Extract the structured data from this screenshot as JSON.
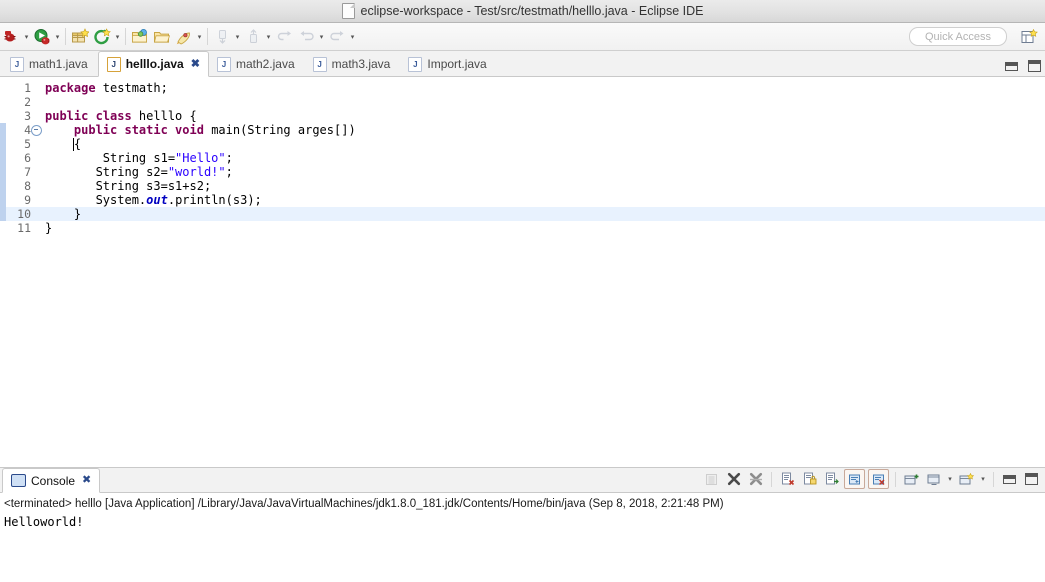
{
  "window": {
    "title": "eclipse-workspace - Test/src/testmath/helllo.java - Eclipse IDE",
    "doc_icon": "document-icon"
  },
  "toolbar": {
    "quick_access_placeholder": "Quick Access",
    "items": [
      {
        "name": "debug-button",
        "icon": "bug-icon"
      },
      {
        "name": "debug-dropdown",
        "icon": "chevron-down-icon"
      },
      {
        "name": "run-button",
        "icon": "run-green-play-icon"
      },
      {
        "name": "run-dropdown",
        "icon": "chevron-down-icon"
      },
      {
        "name": "new-java-package-button",
        "icon": "package-icon"
      },
      {
        "name": "external-tools-button",
        "icon": "external-tools-icon"
      },
      {
        "name": "external-tools-dropdown",
        "icon": "chevron-down-icon"
      },
      {
        "name": "new-folder-button",
        "icon": "folder-star-icon"
      },
      {
        "name": "open-folder-button",
        "icon": "open-folder-icon"
      },
      {
        "name": "search-button",
        "icon": "rocket-search-icon"
      },
      {
        "name": "search-dropdown",
        "icon": "chevron-down-icon"
      },
      {
        "name": "next-annotation-button",
        "icon": "next-annotation-icon"
      },
      {
        "name": "next-annotation-dropdown",
        "icon": "chevron-down-icon"
      },
      {
        "name": "previous-annotation-button",
        "icon": "previous-annotation-icon"
      },
      {
        "name": "previous-annotation-dropdown",
        "icon": "chevron-down-icon"
      },
      {
        "name": "last-edit-location-button",
        "icon": "last-edit-icon"
      },
      {
        "name": "back-button",
        "icon": "back-arrow-icon"
      },
      {
        "name": "back-dropdown",
        "icon": "chevron-down-icon"
      },
      {
        "name": "forward-button",
        "icon": "forward-arrow-icon"
      },
      {
        "name": "forward-dropdown",
        "icon": "chevron-down-icon"
      }
    ],
    "perspective_icon": "open-perspective-icon"
  },
  "editor": {
    "tabs": [
      {
        "label": "math1.java",
        "active": false,
        "closable": false
      },
      {
        "label": "helllo.java",
        "active": true,
        "closable": true
      },
      {
        "label": "math2.java",
        "active": false,
        "closable": false
      },
      {
        "label": "math3.java",
        "active": false,
        "closable": false
      },
      {
        "label": "Import.java",
        "active": false,
        "closable": false
      }
    ],
    "tab_icon": "java-file-icon",
    "close_glyph": "✖",
    "minimize_icon": "minimize-icon",
    "maximize_icon": "maximize-icon",
    "lines": [
      {
        "num": "1",
        "fold": false,
        "changed": false,
        "current": false,
        "tokens": [
          {
            "t": "package ",
            "c": "kw"
          },
          {
            "t": "testmath;",
            "c": ""
          }
        ]
      },
      {
        "num": "2",
        "fold": false,
        "changed": false,
        "current": false,
        "tokens": [
          {
            "t": "",
            "c": ""
          }
        ]
      },
      {
        "num": "3",
        "fold": false,
        "changed": false,
        "current": false,
        "tokens": [
          {
            "t": "public class ",
            "c": "kw"
          },
          {
            "t": "helllo {",
            "c": ""
          }
        ]
      },
      {
        "num": "4",
        "fold": true,
        "changed": true,
        "current": false,
        "tokens": [
          {
            "t": "    ",
            "c": ""
          },
          {
            "t": "public static void ",
            "c": "kw"
          },
          {
            "t": "main(String arges[])",
            "c": ""
          }
        ]
      },
      {
        "num": "5",
        "fold": false,
        "changed": true,
        "current": false,
        "tokens": [
          {
            "t": "    {",
            "c": ""
          }
        ]
      },
      {
        "num": "6",
        "fold": false,
        "changed": true,
        "current": false,
        "tokens": [
          {
            "t": "        String s1=",
            "c": ""
          },
          {
            "t": "\"Hello\"",
            "c": "str"
          },
          {
            "t": ";",
            "c": ""
          }
        ]
      },
      {
        "num": "7",
        "fold": false,
        "changed": true,
        "current": false,
        "tokens": [
          {
            "t": "       String s2=",
            "c": ""
          },
          {
            "t": "\"world!\"",
            "c": "str"
          },
          {
            "t": ";",
            "c": ""
          }
        ]
      },
      {
        "num": "8",
        "fold": false,
        "changed": true,
        "current": false,
        "tokens": [
          {
            "t": "       String s3=s1+s2;",
            "c": ""
          }
        ]
      },
      {
        "num": "9",
        "fold": false,
        "changed": true,
        "current": false,
        "tokens": [
          {
            "t": "       System.",
            "c": ""
          },
          {
            "t": "out",
            "c": "fld"
          },
          {
            "t": ".println(s3);",
            "c": ""
          }
        ]
      },
      {
        "num": "10",
        "fold": false,
        "changed": true,
        "current": true,
        "tokens": [
          {
            "t": "    }",
            "c": ""
          }
        ]
      },
      {
        "num": "11",
        "fold": false,
        "changed": false,
        "current": false,
        "tokens": [
          {
            "t": "}",
            "c": ""
          }
        ]
      }
    ]
  },
  "console": {
    "tab_label": "Console",
    "tab_icon": "console-icon",
    "close_glyph": "✖",
    "toolbar_items": [
      {
        "name": "scroll-lock-button",
        "icon": "scroll-lock-icon",
        "enabled": false
      },
      {
        "name": "terminate-button",
        "icon": "terminate-x-icon",
        "enabled": true
      },
      {
        "name": "remove-all-terminated-button",
        "icon": "remove-all-terminated-icon",
        "enabled": true
      },
      {
        "name": "clear-console-button",
        "icon": "clear-console-icon",
        "enabled": true
      },
      {
        "name": "lock-console-button",
        "icon": "lock-icon",
        "enabled": true
      },
      {
        "name": "show-console-on-output-button",
        "icon": "show-on-output-icon",
        "enabled": true
      },
      {
        "name": "word-wrap-button",
        "icon": "word-wrap-icon",
        "enabled": true
      },
      {
        "name": "pin-console-button",
        "icon": "pin-console-icon",
        "enabled": true
      },
      {
        "name": "open-console-button",
        "icon": "open-console-icon",
        "enabled": true
      },
      {
        "name": "display-selected-console-button",
        "icon": "display-console-icon",
        "enabled": true
      },
      {
        "name": "display-selected-console-dropdown",
        "icon": "chevron-down-icon",
        "enabled": true
      },
      {
        "name": "new-console-view-button",
        "icon": "new-console-icon",
        "enabled": true
      },
      {
        "name": "new-console-view-dropdown",
        "icon": "chevron-down-icon",
        "enabled": true
      },
      {
        "name": "minimize-console-button",
        "icon": "minimize-icon",
        "enabled": true
      },
      {
        "name": "maximize-console-button",
        "icon": "maximize-icon",
        "enabled": true
      }
    ],
    "launch_line": "<terminated> helllo [Java Application] /Library/Java/JavaVirtualMachines/jdk1.8.0_181.jdk/Contents/Home/bin/java (Sep 8, 2018, 2:21:48 PM)",
    "output": "Helloworld!"
  },
  "colors": {
    "keyword": "#7F0055",
    "string": "#2A00FF",
    "field": "#0000C0",
    "current_line": "#E8F2FE",
    "change_bar": "#BED2EE",
    "editor_bg": "#FFFFFF",
    "chrome_bg": "#F2F2F2"
  }
}
